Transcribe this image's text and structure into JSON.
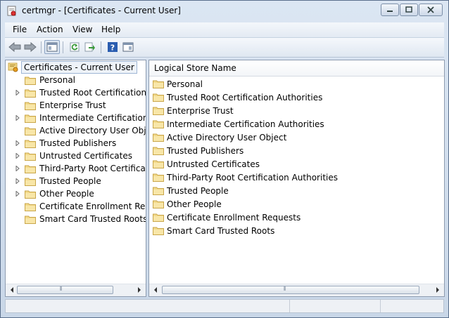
{
  "window": {
    "title": "certmgr - [Certificates - Current User]",
    "buttons": [
      "minimize",
      "maximize",
      "close"
    ]
  },
  "menubar": {
    "items": [
      "File",
      "Action",
      "View",
      "Help"
    ]
  },
  "toolbar": {
    "buttons": [
      "back-arrow-icon",
      "forward-arrow-icon",
      "show-hide-tree-icon",
      "refresh-icon",
      "export-list-icon",
      "help-icon",
      "properties-icon"
    ]
  },
  "tree": {
    "root_label": "Certificates - Current User",
    "items": [
      {
        "label": "Personal",
        "expandable": false
      },
      {
        "label": "Trusted Root Certification Au",
        "expandable": true
      },
      {
        "label": "Enterprise Trust",
        "expandable": false
      },
      {
        "label": "Intermediate Certification Au",
        "expandable": true
      },
      {
        "label": "Active Directory User Object",
        "expandable": false
      },
      {
        "label": "Trusted Publishers",
        "expandable": true
      },
      {
        "label": "Untrusted Certificates",
        "expandable": true
      },
      {
        "label": "Third-Party Root Certification",
        "expandable": true
      },
      {
        "label": "Trusted People",
        "expandable": true
      },
      {
        "label": "Other People",
        "expandable": true
      },
      {
        "label": "Certificate Enrollment Reques",
        "expandable": false
      },
      {
        "label": "Smart Card Trusted Roots",
        "expandable": false
      }
    ]
  },
  "list": {
    "column_header": "Logical Store Name",
    "items": [
      "Personal",
      "Trusted Root Certification Authorities",
      "Enterprise Trust",
      "Intermediate Certification Authorities",
      "Active Directory User Object",
      "Trusted Publishers",
      "Untrusted Certificates",
      "Third-Party Root Certification Authorities",
      "Trusted People",
      "Other People",
      "Certificate Enrollment Requests",
      "Smart Card Trusted Roots"
    ]
  },
  "colors": {
    "folder_fill": "#f2d98a",
    "folder_stroke": "#c9a64a",
    "help_blue": "#2a5db0",
    "refresh_green": "#3a9a3a"
  }
}
